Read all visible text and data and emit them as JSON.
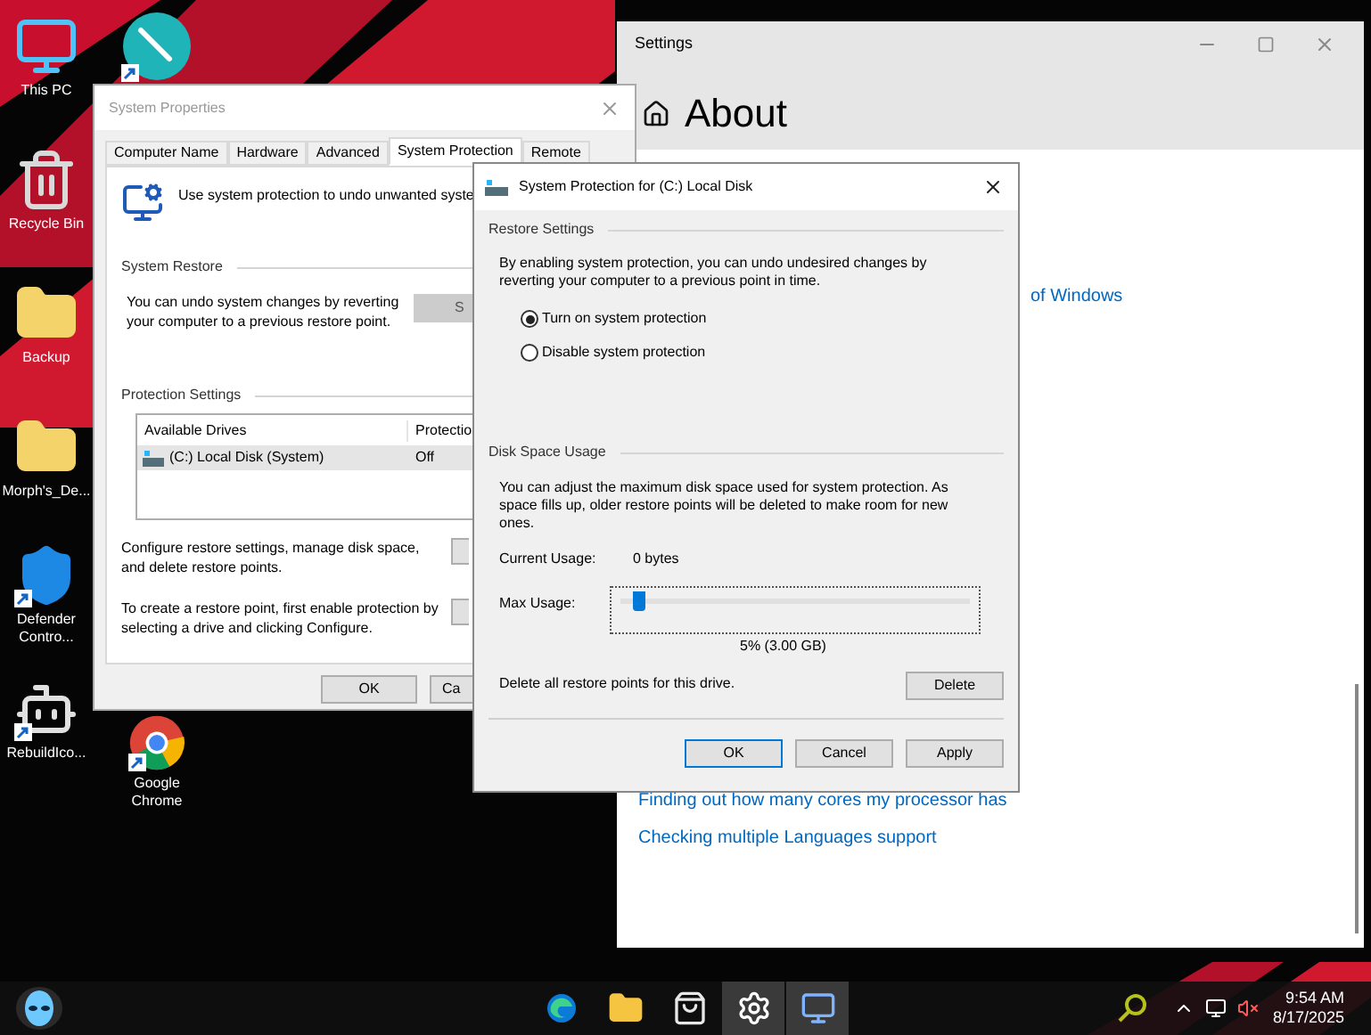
{
  "desktop": {
    "icons": [
      {
        "label": "This PC",
        "kind": "pc",
        "shortcut": false
      },
      {
        "label": "Recycle Bin",
        "kind": "bin",
        "shortcut": false
      },
      {
        "label": "Backup",
        "kind": "folder",
        "shortcut": false
      },
      {
        "label": "Morph's_De...",
        "kind": "folder",
        "shortcut": false
      },
      {
        "label": "Defender Contro...",
        "kind": "shield",
        "shortcut": true
      },
      {
        "label": "RebuildIco...",
        "kind": "robot",
        "shortcut": true
      }
    ],
    "icons_column_2": [
      {
        "kind": "pen",
        "shortcut": true
      },
      {
        "label": "Google Chrome",
        "kind": "chrome",
        "shortcut": true
      }
    ]
  },
  "settings": {
    "title": "Settings",
    "heading": "About",
    "links": [
      "of Windows",
      "Finding out how many cores my processor has",
      "Checking multiple Languages support"
    ]
  },
  "system_properties": {
    "title": "System Properties",
    "tabs": [
      {
        "label": "Computer Name",
        "selected": false
      },
      {
        "label": "Hardware",
        "selected": false
      },
      {
        "label": "Advanced",
        "selected": false
      },
      {
        "label": "System Protection",
        "selected": true
      },
      {
        "label": "Remote",
        "selected": false
      }
    ],
    "intro": "Use system protection to undo unwanted syste",
    "system_restore": {
      "heading": "System Restore",
      "text": "You can undo system changes by reverting your computer to a previous restore point.",
      "button": "S"
    },
    "protection_settings": {
      "heading": "Protection Settings",
      "columns": [
        "Available Drives",
        "Protectio"
      ],
      "rows": [
        {
          "drive": "(C:) Local Disk (System)",
          "protection": "Off",
          "selected": true
        }
      ],
      "configure_text": "Configure restore settings, manage disk space, and delete restore points.",
      "create_text": "To create a restore point, first enable protection by selecting a drive and clicking Configure."
    },
    "buttons": [
      "OK",
      "Ca"
    ]
  },
  "dialog": {
    "title": "System Protection for (C:) Local Disk",
    "restore_settings": {
      "heading": "Restore Settings",
      "text": "By enabling system protection, you can undo undesired changes by reverting your computer to a previous point in time.",
      "options": [
        {
          "label": "Turn on system protection",
          "selected": true
        },
        {
          "label": "Disable system protection",
          "selected": false
        }
      ]
    },
    "disk_space": {
      "heading": "Disk Space Usage",
      "text": "You can adjust the maximum disk space used for system protection. As space fills up, older restore points will be deleted to make room for new ones.",
      "current_usage_label": "Current Usage:",
      "current_usage_value": "0 bytes",
      "max_usage_label": "Max Usage:",
      "slider": {
        "level": 0.05
      },
      "reading": "5% (3.00 GB)",
      "delete_text": "Delete all restore points for this drive.",
      "delete_button": "Delete"
    },
    "buttons": [
      {
        "label": "OK",
        "default": true
      },
      {
        "label": "Cancel",
        "default": false
      },
      {
        "label": "Apply",
        "default": false
      }
    ]
  },
  "taskbar": {
    "apps": [
      {
        "kind": "edge",
        "active": false
      },
      {
        "kind": "explorer",
        "active": false
      },
      {
        "kind": "store",
        "active": false
      },
      {
        "kind": "settings",
        "active": true
      },
      {
        "kind": "sysprops",
        "active": true
      }
    ],
    "clock": {
      "time": "9:54 AM",
      "date": "8/17/2025"
    }
  }
}
